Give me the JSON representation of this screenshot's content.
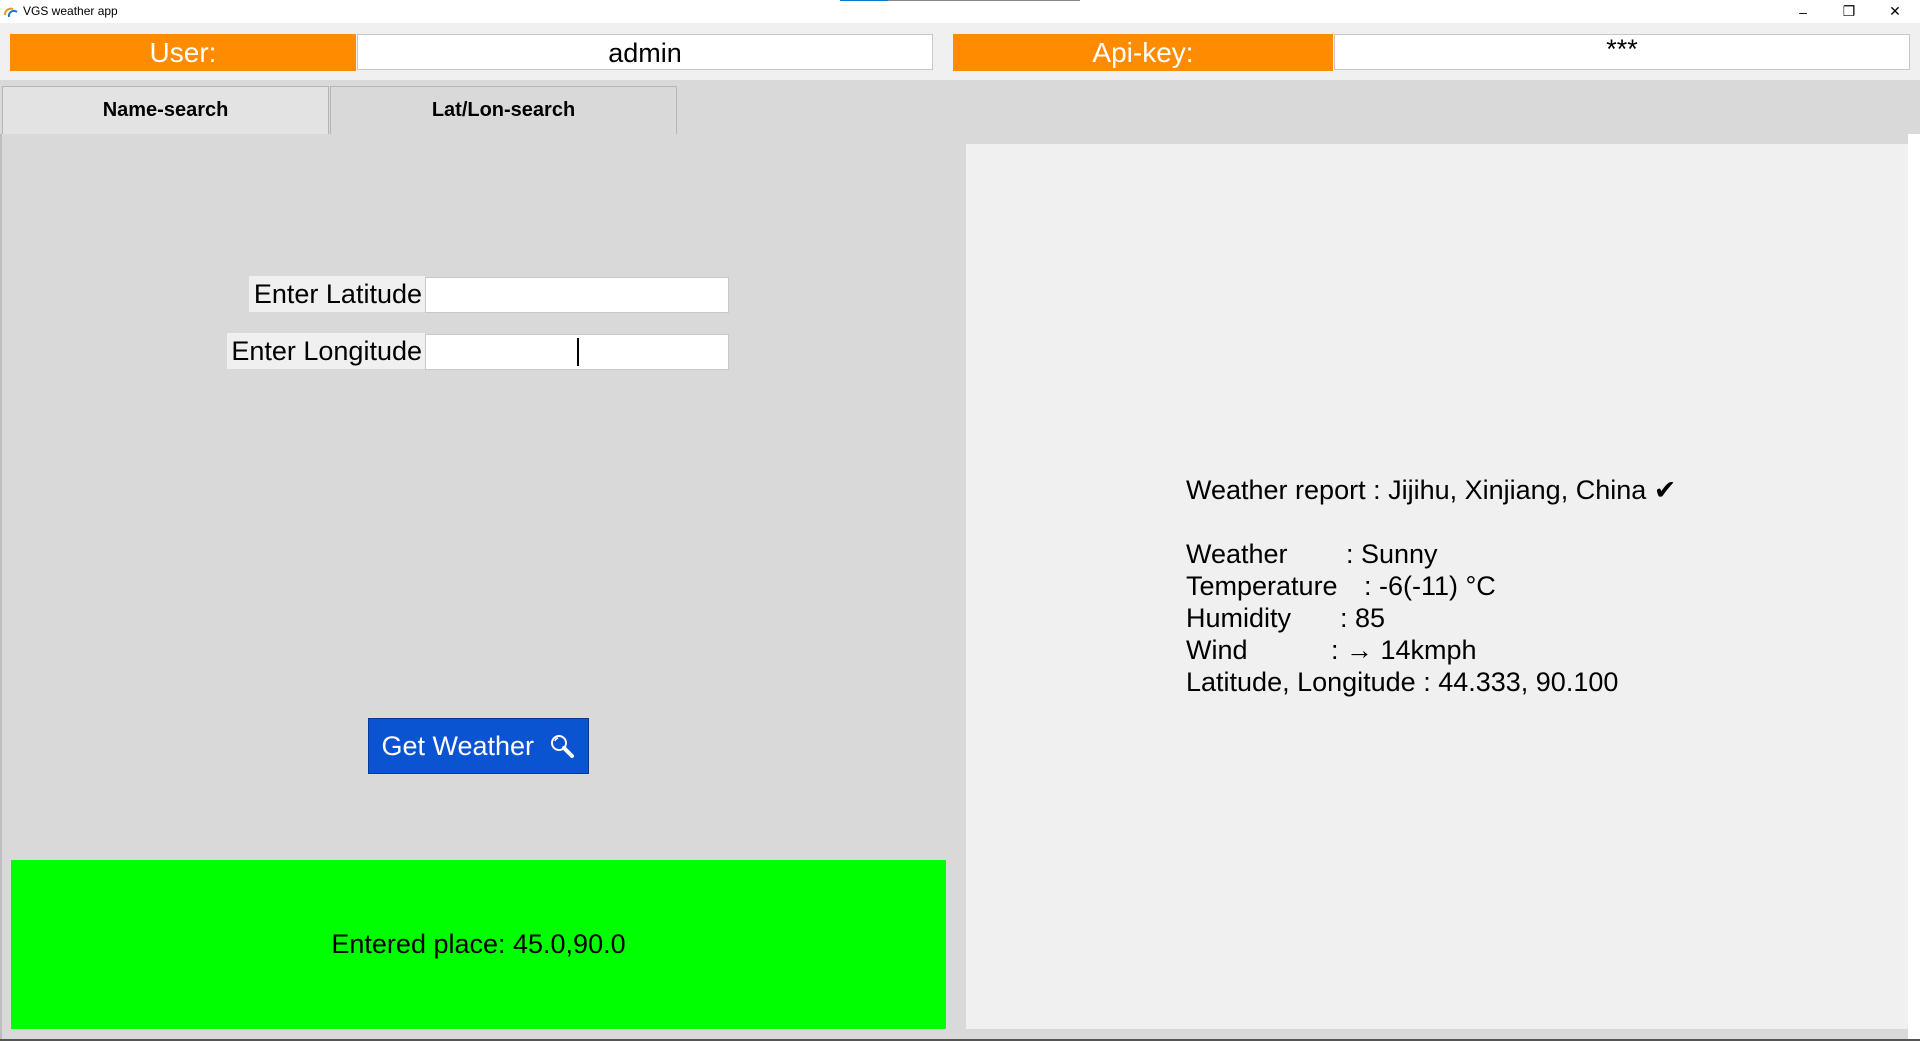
{
  "window": {
    "title": "VGS weather app",
    "minimize_glyph": "–",
    "maximize_glyph": "❐",
    "close_glyph": "✕"
  },
  "credentials": {
    "user_label": "User:",
    "user_value": "admin",
    "api_label": "Api-key:",
    "api_value": "***"
  },
  "tabs": [
    {
      "label": "Name-search",
      "active": false
    },
    {
      "label": "Lat/Lon-search",
      "active": true
    }
  ],
  "form": {
    "latitude_label": "Enter Latitude",
    "latitude_value": "",
    "longitude_label": "Enter Longitude",
    "longitude_value": "",
    "button_label": "Get Weather",
    "button_icon": "magnifier-icon"
  },
  "status": {
    "text": "Entered place: 45.0,90.0",
    "color": "#00ff00"
  },
  "report": {
    "title": "Weather report : Jijihu, Xinjiang, China ✔",
    "rows": [
      {
        "label": "Weather",
        "value": ": Sunny"
      },
      {
        "label": "Temperature",
        "value": ": -6(-11) °C"
      },
      {
        "label": "Humidity",
        "value": ": 85"
      },
      {
        "label": "Wind",
        "value": ": → 14kmph"
      },
      {
        "label": "Latitude, Longitude",
        "value": " : 44.333, 90.100"
      }
    ]
  },
  "colors": {
    "accent_orange": "#ff8c00",
    "button_blue": "#0b54d1",
    "status_green": "#00ff00"
  }
}
